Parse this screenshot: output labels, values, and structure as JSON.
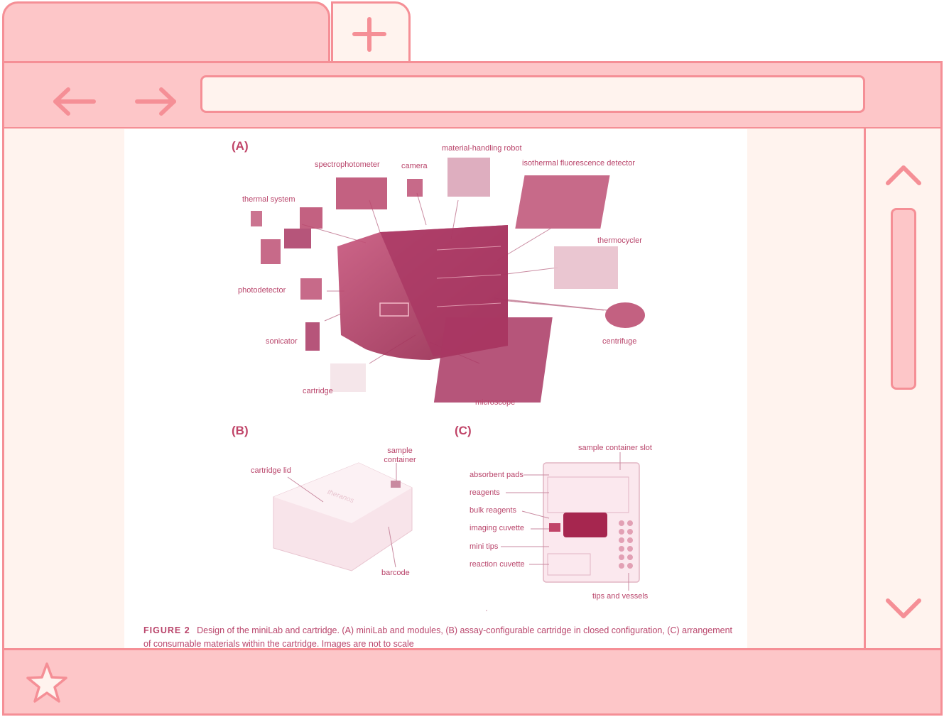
{
  "browser": {
    "new_tab_icon": "plus-icon",
    "back_icon": "arrow-left-icon",
    "forward_icon": "arrow-right-icon",
    "scroll_up_icon": "chevron-up-icon",
    "scroll_down_icon": "chevron-down-icon",
    "bookmark_icon": "star-icon",
    "url": ""
  },
  "figure": {
    "panel_a": "(A)",
    "panel_b": "(B)",
    "panel_c": "(C)",
    "a_labels": {
      "material_handling_robot": "material-handling robot",
      "spectrophotometer": "spectrophotometer",
      "camera": "camera",
      "isothermal": "isothermal fluorescence detector",
      "thermal_system": "thermal system",
      "thermocycler": "thermocycler",
      "photodetector": "photodetector",
      "sonicator": "sonicator",
      "centrifuge": "centrifuge",
      "cartridge": "cartridge",
      "microscope": "microscope"
    },
    "b_labels": {
      "sample_container": "sample container",
      "cartridge_lid": "cartridge lid",
      "barcode": "barcode",
      "brand": "theranos"
    },
    "c_labels": {
      "sample_container_slot": "sample container slot",
      "absorbent_pads": "absorbent pads",
      "reagents": "reagents",
      "bulk_reagents": "bulk reagents",
      "imaging_cuvette": "imaging cuvette",
      "mini_tips": "mini tips",
      "reaction_cuvette": "reaction cuvette",
      "tips_and_vessels": "tips and vessels"
    },
    "caption_label": "FIGURE 2",
    "caption_text": "Design of the miniLab and cartridge. (A) miniLab and modules, (B) assay-configurable cartridge in closed configuration, (C) arrangement of consumable materials within the cartridge. Images are not to scale"
  },
  "colors": {
    "chrome_fill": "#fdc6c8",
    "chrome_border": "#f58f96",
    "page_bg": "#fff3ee",
    "figure_ink": "#b9456b"
  }
}
